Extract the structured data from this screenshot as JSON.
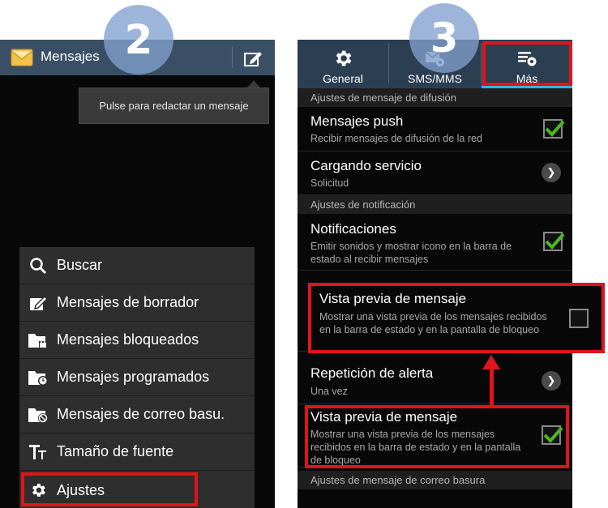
{
  "badges": {
    "left": "2",
    "right": "3"
  },
  "left_screen": {
    "app_title": "Mensajes",
    "app_icon": "envelope-icon",
    "compose_icon": "compose-icon",
    "tooltip": "Pulse para redactar un mensaje",
    "menu": [
      {
        "label": "Buscar",
        "icon": "search-icon"
      },
      {
        "label": "Mensajes de borrador",
        "icon": "draft-icon"
      },
      {
        "label": "Mensajes bloqueados",
        "icon": "locked-folder-icon"
      },
      {
        "label": "Mensajes programados",
        "icon": "scheduled-folder-icon"
      },
      {
        "label": "Mensajes de correo basu.",
        "icon": "spam-folder-icon"
      },
      {
        "label": "Tamaño de fuente",
        "icon": "font-size-icon"
      },
      {
        "label": "Ajustes",
        "icon": "gear-icon"
      }
    ],
    "highlighted_item": "Ajustes"
  },
  "right_screen": {
    "tabs": [
      {
        "label": "General",
        "icon": "gear-icon"
      },
      {
        "label": "SMS/MMS",
        "icon": "sms-settings-icon"
      },
      {
        "label": "Más",
        "icon": "more-settings-icon",
        "selected": true
      }
    ],
    "sections": {
      "difusion": "Ajustes de mensaje de difusión",
      "notificacion": "Ajustes de notificación",
      "correo_basura": "Ajustes de mensaje de correo basura"
    },
    "rows": {
      "push": {
        "title": "Mensajes push",
        "subtitle": "Recibir mensajes de difusión de la red",
        "checked": true
      },
      "cargando": {
        "title": "Cargando servicio",
        "subtitle": "Solicitud"
      },
      "notificaciones": {
        "title": "Notificaciones",
        "subtitle": "Emitir sonidos y mostrar icono en la barra de estado al recibir mensajes",
        "checked": true
      },
      "repeticion": {
        "title": "Repetición de alerta",
        "subtitle": "Una vez"
      },
      "vista_previa": {
        "title": "Vista previa de mensaje",
        "subtitle": "Mostrar una vista previa de los mensajes recibidos en la barra de estado y en la pantalla de bloqueo",
        "checked": true
      }
    },
    "callout": {
      "title": "Vista previa de mensaje",
      "subtitle": "Mostrar una vista previa de los mensajes recibidos en la barra de estado y en la pantalla de bloqueo",
      "checked": false
    }
  },
  "colors": {
    "highlight": "#e0141a",
    "check": "#4cb820",
    "actionbar": "#3a4f65",
    "tabbar": "#2c3e52",
    "accent": "#33b5e5"
  }
}
